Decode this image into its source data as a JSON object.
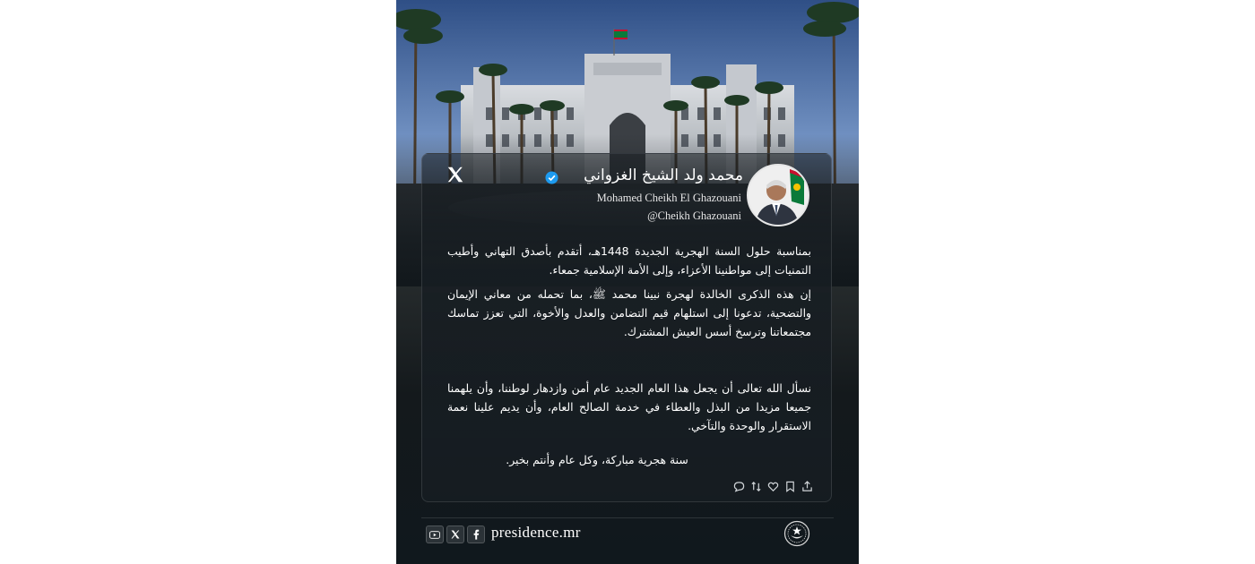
{
  "account": {
    "name_ar": "محمد ولد الشيخ الغزواني",
    "name_en": "Mohamed Cheikh El Ghazouani",
    "handle": "@Cheikh Ghazouani"
  },
  "post": {
    "paragraph1": "بمناسبة حلول السنة الهجرية الجديدة 1448هـ، أتقدم بأصدق التهاني وأطيب التمنيات إلى مواطنينا الأعزاء، وإلى الأمة الإسلامية جمعاء.",
    "paragraph2": "إن هذه الذكرى الخالدة لهجرة نبينا محمد ﷺ، بما تحمله من معاني الإيمان والتضحية، تدعونا إلى استلهام قيم التضامن والعدل والأخوة، التي تعزز تماسك مجتمعاتنا وترسخ أسس العيش المشترك.",
    "paragraph3": "نسأل الله تعالى أن يجعل هذا العام الجديد عام أمن وازدهار لوطننا، وأن يلهمنا جميعا مزيدا من البذل والعطاء في خدمة الصالح العام، وأن يديم علينا نعمة الاستقرار والوحدة والتآخي.",
    "paragraph4": "سنة هجرية مباركة، وكل عام وأنتم بخير."
  },
  "footer": {
    "site": "presidence.mr"
  },
  "icons": {
    "platform": "x-logo-icon",
    "verified": "verified-badge-icon",
    "actions": [
      "share-icon",
      "bookmark-icon",
      "like-icon",
      "repost-icon",
      "reply-icon"
    ],
    "social": [
      "youtube-icon",
      "x-icon",
      "facebook-icon"
    ],
    "emblem": "presidential-emblem-icon"
  },
  "colors": {
    "verified_blue": "#1d9bf0",
    "flag_green": "#0a7a3a",
    "flag_red": "#c8102e",
    "flag_gold": "#f4c300"
  }
}
